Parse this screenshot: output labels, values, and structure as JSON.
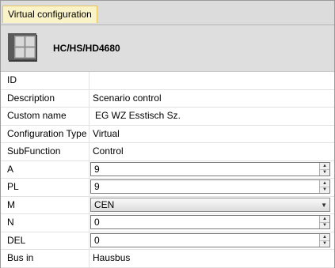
{
  "tab": {
    "label": "Virtual configuration"
  },
  "device": {
    "name": "HC/HS/HD4680",
    "icon": "keypad-device-icon"
  },
  "properties": [
    {
      "label": "ID",
      "value": ""
    },
    {
      "label": "Description",
      "value": "Scenario control"
    },
    {
      "label": "Custom name",
      "value": "EG WZ Esstisch Sz."
    },
    {
      "label": "Configuration Type",
      "value": "Virtual"
    },
    {
      "label": "SubFunction",
      "value": "Control"
    },
    {
      "label": "A",
      "value": "9"
    },
    {
      "label": "PL",
      "value": "9"
    },
    {
      "label": "M",
      "value": "CEN"
    },
    {
      "label": "N",
      "value": "0"
    },
    {
      "label": "DEL",
      "value": "0"
    },
    {
      "label": "Bus in",
      "value": "Hausbus"
    }
  ],
  "icons": {
    "spin_up": "spin-up-icon",
    "spin_down": "spin-down-icon",
    "dropdown": "chevron-down-icon"
  }
}
